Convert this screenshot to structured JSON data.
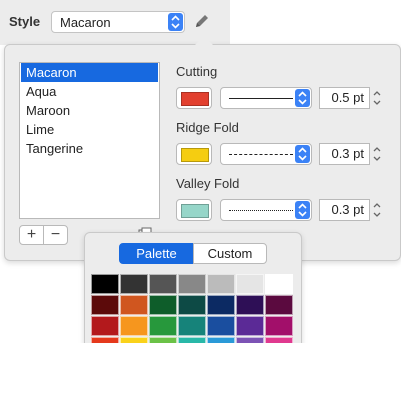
{
  "header": {
    "style_label": "Style",
    "style_value": "Macaron"
  },
  "style_list": {
    "items": [
      {
        "label": "Macaron",
        "selected": true
      },
      {
        "label": "Aqua",
        "selected": false
      },
      {
        "label": "Maroon",
        "selected": false
      },
      {
        "label": "Lime",
        "selected": false
      },
      {
        "label": "Tangerine",
        "selected": false
      }
    ],
    "add_label": "+",
    "remove_label": "−"
  },
  "lines": [
    {
      "label": "Cutting",
      "color": "#e2402f",
      "pattern": "solid",
      "width": "0.5 pt"
    },
    {
      "label": "Ridge Fold",
      "color": "#f5cd11",
      "pattern": "dashed",
      "width": "0.3 pt"
    },
    {
      "label": "Valley Fold",
      "color": "#96d6c9",
      "pattern": "dotted",
      "width": "0.3 pt"
    }
  ],
  "picker": {
    "tabs": [
      {
        "label": "Palette",
        "active": true
      },
      {
        "label": "Custom",
        "active": false
      }
    ],
    "palette": [
      [
        "#000000",
        "#333333",
        "#555555",
        "#888888",
        "#bbbbbb",
        "#e5e5e5",
        "#ffffff"
      ],
      [
        "#5c0a0a",
        "#d0561f",
        "#0e5d2a",
        "#0d4a45",
        "#0c2a63",
        "#2e0f56",
        "#5b0a3f"
      ],
      [
        "#b3191c",
        "#f6961e",
        "#27983c",
        "#16837a",
        "#1a4e9f",
        "#5b2a96",
        "#a20f6a"
      ],
      [
        "#e5391c",
        "#fad21b",
        "#6bc247",
        "#29b8a8",
        "#2a9ad8",
        "#7c53b5",
        "#e0398f"
      ]
    ]
  }
}
